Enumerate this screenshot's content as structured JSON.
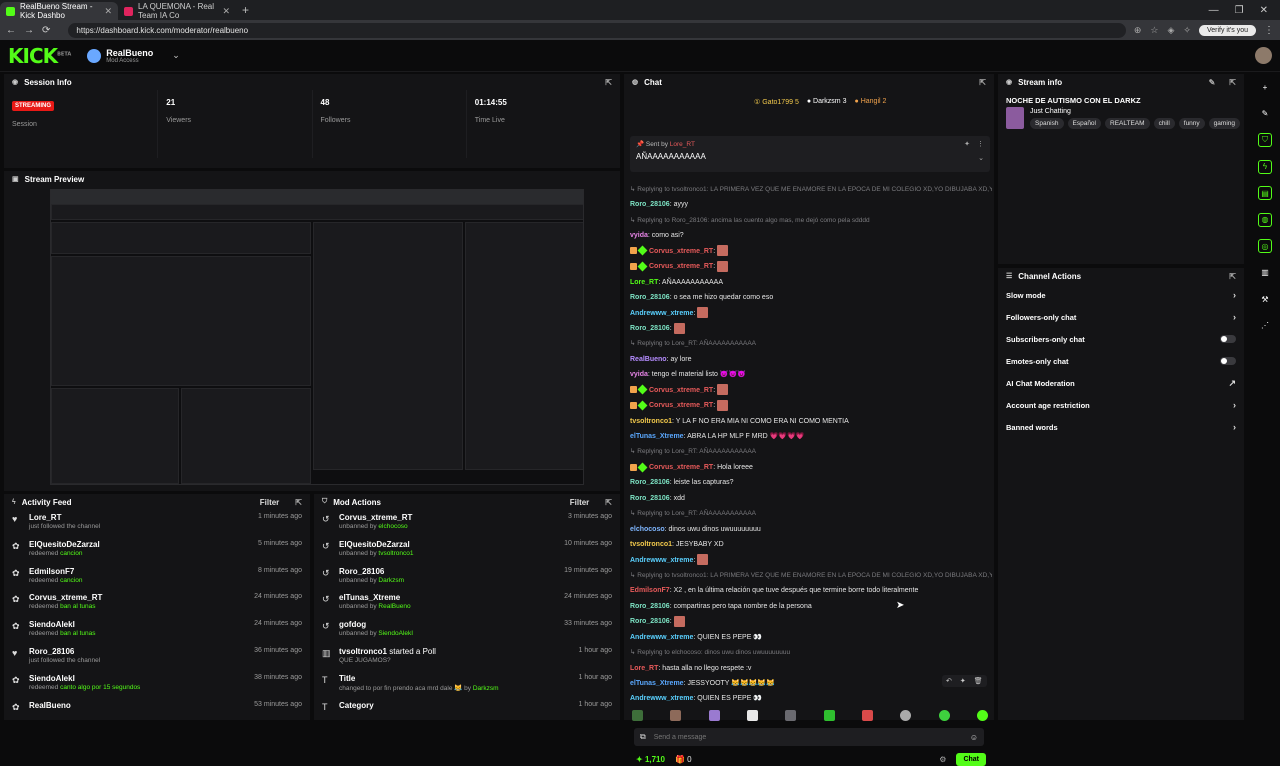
{
  "browser": {
    "tabs": [
      {
        "title": "RealBueno Stream - Kick Dashbo",
        "active": true
      },
      {
        "title": "LA QUEMONA - Real Team IA Co",
        "active": false
      }
    ],
    "url": "https://dashboard.kick.com/moderator/realbueno",
    "verify_label": "Verify it's you"
  },
  "header": {
    "logo": "KICK",
    "logo_badge": "BETA",
    "channel_name": "RealBueno",
    "channel_role": "Mod Access"
  },
  "session": {
    "title": "Session Info",
    "status_badge": "STREAMING",
    "status_label": "Session",
    "viewers_value": "21",
    "viewers_label": "Viewers",
    "followers_value": "48",
    "followers_label": "Followers",
    "time_value": "01:14:55",
    "time_label": "Time Live"
  },
  "preview": {
    "title": "Stream Preview"
  },
  "activity": {
    "title": "Activity Feed",
    "filter": "Filter",
    "items": [
      {
        "icon": "heart",
        "user": "Lore_RT",
        "sub": "just followed the channel",
        "hl": "",
        "time": "1 minutes ago"
      },
      {
        "icon": "redeem",
        "user": "ElQuesitoDeZarzal",
        "sub": "redeemed ",
        "hl": "cancion",
        "time": "5 minutes ago"
      },
      {
        "icon": "redeem",
        "user": "EdmilsonF7",
        "sub": "redeemed ",
        "hl": "cancion",
        "time": "8 minutes ago"
      },
      {
        "icon": "redeem",
        "user": "Corvus_xtreme_RT",
        "sub": "redeemed ",
        "hl": "ban al tunas",
        "time": "24 minutes ago"
      },
      {
        "icon": "redeem",
        "user": "SiendoAlekI",
        "sub": "redeemed ",
        "hl": "ban al tunas",
        "time": "24 minutes ago"
      },
      {
        "icon": "heart",
        "user": "Roro_28106",
        "sub": "just followed the channel",
        "hl": "",
        "time": "36 minutes ago"
      },
      {
        "icon": "redeem",
        "user": "SiendoAlekI",
        "sub": "redeemed ",
        "hl": "canto algo por 15 segundos",
        "time": "38 minutes ago"
      },
      {
        "icon": "redeem",
        "user": "RealBueno",
        "sub": "",
        "hl": "",
        "time": "53 minutes ago"
      }
    ]
  },
  "modactions": {
    "title": "Mod Actions",
    "filter": "Filter",
    "items": [
      {
        "icon": "undo",
        "user": "Corvus_xtreme_RT",
        "act": "",
        "sub": "unbanned by ",
        "hl": "elchocoso",
        "time": "3 minutes ago"
      },
      {
        "icon": "undo",
        "user": "ElQuesitoDeZarzal",
        "act": "",
        "sub": "unbanned by ",
        "hl": "tvsoltronco1",
        "time": "10 minutes ago"
      },
      {
        "icon": "undo",
        "user": "Roro_28106",
        "act": "",
        "sub": "unbanned by ",
        "hl": "Darkzsm",
        "time": "19 minutes ago"
      },
      {
        "icon": "undo",
        "user": "elTunas_Xtreme",
        "act": "",
        "sub": "unbanned by ",
        "hl": "RealBueno",
        "time": "24 minutes ago"
      },
      {
        "icon": "undo",
        "user": "gofdog",
        "act": "",
        "sub": "unbanned by ",
        "hl": "SiendoAlekI",
        "time": "33 minutes ago"
      },
      {
        "icon": "poll",
        "user": "tvsoltronco1",
        "act": " started a Poll",
        "sub": "QUE JUGAMOS?",
        "hl": "",
        "time": "1 hour ago"
      },
      {
        "icon": "title",
        "user": "Title",
        "act": "",
        "sub": "changed to por fin prendo aca mrd dale 😹 by ",
        "hl": "Darkzsm",
        "time": "1 hour ago"
      },
      {
        "icon": "title",
        "user": "Category",
        "act": "",
        "sub": "",
        "hl": "",
        "time": "1 hour ago"
      }
    ]
  },
  "chat": {
    "title": "Chat",
    "leaderboard": [
      {
        "name": "Gato1799",
        "pts": "5"
      },
      {
        "name": "Darkzsm",
        "pts": "3"
      },
      {
        "name": "Hangil",
        "pts": "2"
      }
    ],
    "pinned_by_label": "Sent by ",
    "pinned_by_user": "Lore_RT",
    "pinned_msg": "AÑAAAAAAAAAAA",
    "messages": [
      {
        "t": "rp",
        "text": "↳ Replying to tvsoltronco1: LA PRIMERA VEZ QUE ME ENAMORE EN LA EPOCA DE MI COLEGIO XD,YO DIBUJABA XD,Y ..."
      },
      {
        "t": "m",
        "u": "Roro_28106",
        "c": "c-roro",
        "text": ": ayyy"
      },
      {
        "t": "rp",
        "text": "↳ Replying to Roro_28106: ancima las cuento algo mas, me dejó como pela sdddd"
      },
      {
        "t": "m",
        "u": "vyida",
        "c": "c-vy",
        "text": ": como asi?"
      },
      {
        "t": "m",
        "u": "Corvus_xtreme_RT",
        "c": "c-corv",
        "text": ": ",
        "badges": true,
        "emote": true
      },
      {
        "t": "m",
        "u": "Corvus_xtreme_RT",
        "c": "c-corv",
        "text": ": ",
        "badges": true,
        "emote": true
      },
      {
        "t": "m",
        "u": "Lore_RT",
        "c": "c-lore",
        "text": ": AÑAAAAAAAAAAA"
      },
      {
        "t": "m",
        "u": "Roro_28106",
        "c": "c-roro",
        "text": ": o sea me hizo quedar como eso"
      },
      {
        "t": "m",
        "u": "Andrewww_xtreme",
        "c": "c-andr",
        "text": ": ",
        "emote": true
      },
      {
        "t": "m",
        "u": "Roro_28106",
        "c": "c-roro",
        "text": ": ",
        "emote": true
      },
      {
        "t": "rp",
        "text": "↳ Replying to Lore_RT: AÑAAAAAAAAAAA"
      },
      {
        "t": "m",
        "u": "RealBueno",
        "c": "c-rb",
        "text": ": ay lore"
      },
      {
        "t": "m",
        "u": "vyida",
        "c": "c-vy",
        "text": ": tengo el material listo 😈😈😈"
      },
      {
        "t": "m",
        "u": "Corvus_xtreme_RT",
        "c": "c-corv",
        "text": ": ",
        "badges": true,
        "emote": true
      },
      {
        "t": "m",
        "u": "Corvus_xtreme_RT",
        "c": "c-corv",
        "text": ": ",
        "badges": true,
        "emote": true
      },
      {
        "t": "m",
        "u": "tvsoltronco1",
        "c": "c-tv",
        "text": ": Y LA F NO ERA MIA NI COMO ERA NI COMO MENTIA"
      },
      {
        "t": "m",
        "u": "elTunas_Xtreme",
        "c": "c-el",
        "text": ": ABRA LA HP MLP F MRD 💗💗💗💗"
      },
      {
        "t": "rp",
        "text": "↳ Replying to Lore_RT: AÑAAAAAAAAAAA"
      },
      {
        "t": "m",
        "u": "Corvus_xtreme_RT",
        "c": "c-corv",
        "text": ": Hola loreee",
        "badges": true
      },
      {
        "t": "m",
        "u": "Roro_28106",
        "c": "c-roro",
        "text": ": leiste las capturas?"
      },
      {
        "t": "m",
        "u": "Roro_28106",
        "c": "c-roro",
        "text": ": xdd"
      },
      {
        "t": "rp",
        "text": "↳ Replying to Lore_RT: AÑAAAAAAAAAAA"
      },
      {
        "t": "m",
        "u": "elchocoso",
        "c": "c-ech",
        "text": ": dinos uwu dinos uwuuuuuuuu"
      },
      {
        "t": "m",
        "u": "tvsoltronco1",
        "c": "c-tv",
        "text": ": JESYBABY XD"
      },
      {
        "t": "m",
        "u": "Andrewww_xtreme",
        "c": "c-andr",
        "text": ": ",
        "emote": true
      },
      {
        "t": "rp",
        "text": "↳ Replying to tvsoltronco1: LA PRIMERA VEZ QUE ME ENAMORE EN LA EPOCA DE MI COLEGIO XD,YO DIBUJABA XD,Y ..."
      },
      {
        "t": "m",
        "u": "EdmilsonF7",
        "c": "c-corv",
        "text": ": X2 , en la última relación que tuve después que termine borre todo literalmente"
      },
      {
        "t": "m",
        "u": "Roro_28106",
        "c": "c-roro",
        "text": ": compartiras pero tapa nombre de la persona"
      },
      {
        "t": "m",
        "u": "Roro_28106",
        "c": "c-roro",
        "text": ": ",
        "emote": true
      },
      {
        "t": "m",
        "u": "Andrewww_xtreme",
        "c": "c-andr",
        "text": ": QUIEN ES PEPE 👀"
      },
      {
        "t": "rp",
        "text": "↳ Replying to elchocoso: dinos uwu dinos uwuuuuuuuu"
      },
      {
        "t": "m",
        "u": "Lore_RT",
        "c": "c-corv",
        "text": ": hasta alla no llego respete :v"
      },
      {
        "t": "m",
        "u": "elTunas_Xtreme",
        "c": "c-el",
        "text": ": JESSYOOTY 😹😹😹😹😹"
      },
      {
        "t": "m",
        "u": "Andrewww_xtreme",
        "c": "c-andr",
        "text": ": QUIEN ES PEPE 👀"
      }
    ],
    "input_placeholder": "Send a message",
    "points": "1,710",
    "gift_count": "0",
    "chat_button": "Chat"
  },
  "streaminfo": {
    "title": "Stream info",
    "stream_title": "NOCHE DE AUTISMO CON EL DARKZ",
    "category": "Just Chatting",
    "tags": [
      "Spanish",
      "Español",
      "REALTEAM",
      "chill",
      "funny",
      "gaming"
    ]
  },
  "channelactions": {
    "title": "Channel Actions",
    "items": [
      {
        "label": "Slow mode",
        "ctl": "chevron"
      },
      {
        "label": "Followers-only chat",
        "ctl": "chevron"
      },
      {
        "label": "Subscribers-only chat",
        "ctl": "toggle"
      },
      {
        "label": "Emotes-only chat",
        "ctl": "toggle"
      },
      {
        "label": "AI Chat Moderation",
        "ctl": "external"
      },
      {
        "label": "Account age restriction",
        "ctl": "chevron"
      },
      {
        "label": "Banned words",
        "ctl": "chevron"
      }
    ]
  },
  "colors": {
    "brand": "#53fc18",
    "live": "#e91916"
  }
}
